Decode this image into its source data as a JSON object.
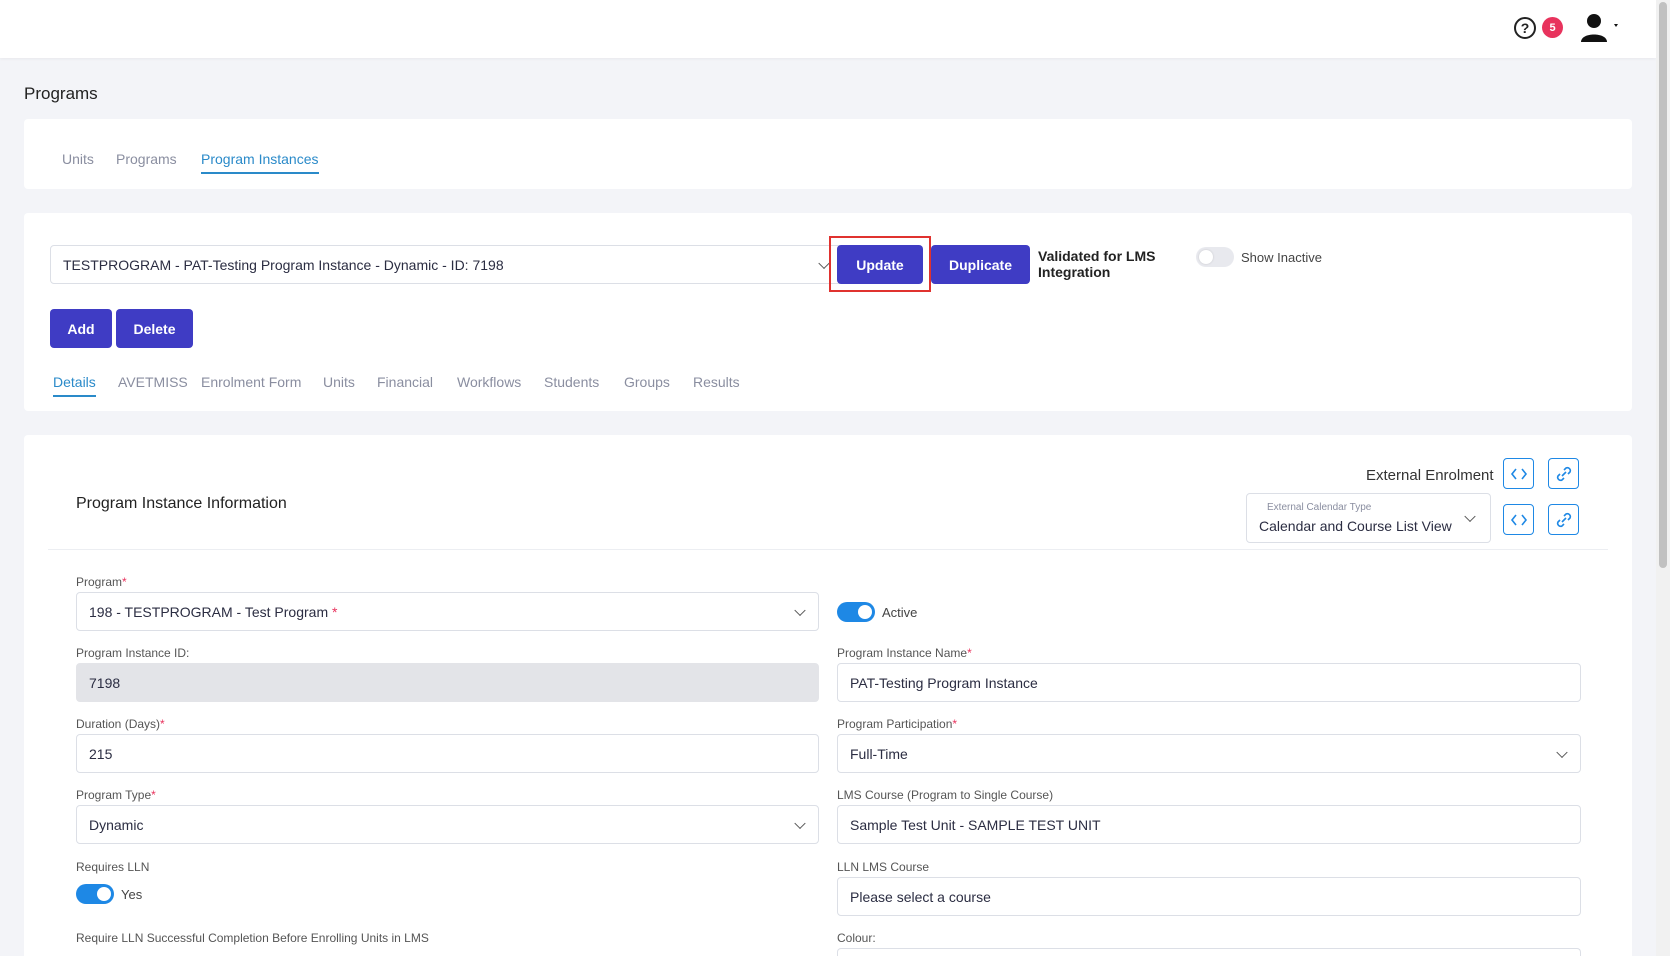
{
  "header": {
    "help_icon": "question-circle-icon",
    "notification_count": "5",
    "avatar_icon": "user-icon"
  },
  "page": {
    "title": "Programs"
  },
  "top_tabs": [
    {
      "label": "Units",
      "active": false
    },
    {
      "label": "Programs",
      "active": false
    },
    {
      "label": "Program Instances",
      "active": true
    }
  ],
  "instance_select": {
    "value": "TESTPROGRAM - PAT-Testing Program Instance - Dynamic - ID: 7198"
  },
  "actions": {
    "update_label": "Update",
    "duplicate_label": "Duplicate",
    "add_label": "Add",
    "delete_label": "Delete",
    "lms_validated_label": "Validated for LMS Integration",
    "show_inactive_label": "Show Inactive",
    "highlight_color": "#e0322f",
    "button_color": "#3f3cc4"
  },
  "sub_tabs": [
    {
      "label": "Details",
      "active": true
    },
    {
      "label": "AVETMISS",
      "active": false
    },
    {
      "label": "Enrolment Form",
      "active": false
    },
    {
      "label": "Units",
      "active": false
    },
    {
      "label": "Financial",
      "active": false
    },
    {
      "label": "Workflows",
      "active": false
    },
    {
      "label": "Students",
      "active": false
    },
    {
      "label": "Groups",
      "active": false
    },
    {
      "label": "Results",
      "active": false
    }
  ],
  "form": {
    "section_title": "Program Instance Information",
    "external_enrolment_label": "External Enrolment",
    "external_calendar": {
      "label": "External Calendar Type",
      "value": "Calendar and Course List View"
    },
    "program": {
      "label": "Program",
      "value": "198 - TESTPROGRAM - Test Program",
      "required_mark": "*"
    },
    "active_label": "Active",
    "program_instance_id": {
      "label": "Program Instance ID:",
      "value": "7198"
    },
    "program_instance_name": {
      "label": "Program Instance Name",
      "value": "PAT-Testing Program Instance"
    },
    "duration": {
      "label": "Duration (Days)",
      "value": "215"
    },
    "participation": {
      "label": "Program Participation",
      "value": "Full-Time"
    },
    "program_type": {
      "label": "Program Type",
      "value": "Dynamic"
    },
    "lms_course": {
      "label": "LMS Course (Program to Single Course)",
      "value": "Sample Test Unit - SAMPLE TEST UNIT"
    },
    "requires_lln": {
      "label": "Requires LLN",
      "toggle_label": "Yes"
    },
    "lln_lms_course": {
      "label": "LLN LMS Course",
      "placeholder": "Please select a course"
    },
    "require_lln_completion_label": "Require LLN Successful Completion Before Enrolling Units in LMS",
    "colour_label": "Colour:"
  }
}
